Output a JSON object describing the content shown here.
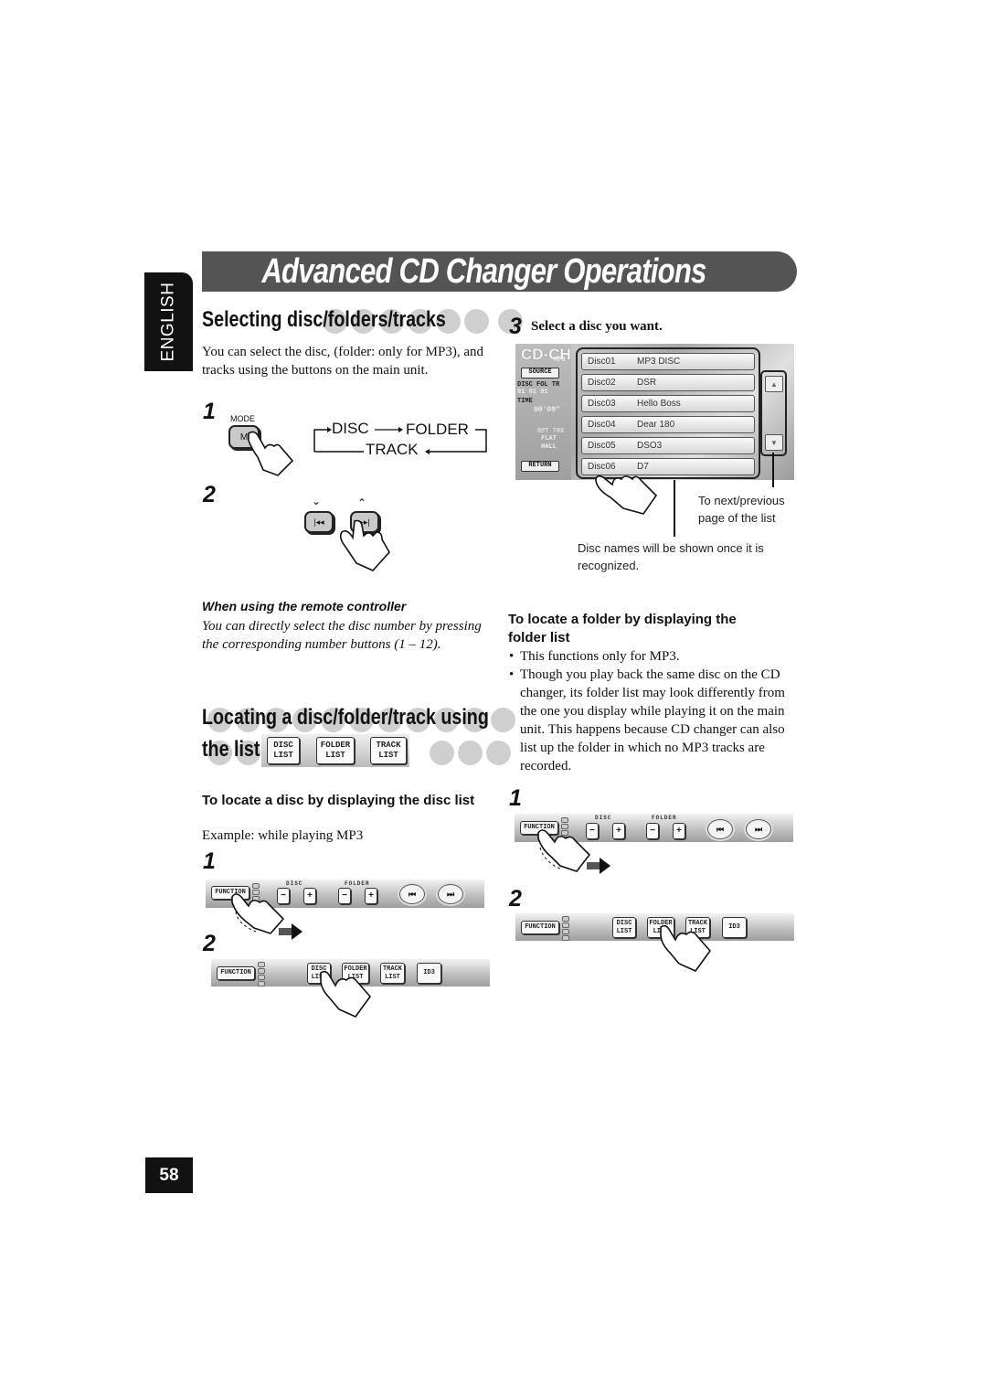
{
  "page": {
    "title": "Advanced CD Changer Operations",
    "language_tab": "ENGLISH",
    "page_number": "58"
  },
  "section1": {
    "heading": "Selecting disc/folders/tracks",
    "intro": "You can select the disc, (folder: only for MP3), and tracks using the buttons on the main unit.",
    "step1_number": "1",
    "mode_label": "MODE",
    "mode_button": "M",
    "cycle": {
      "disc": "DISC",
      "folder": "FOLDER",
      "track": "TRACK"
    },
    "step2_number": "2",
    "prev_button_icon": "skip-back-icon",
    "next_button_icon": "skip-forward-icon",
    "remote_heading": "When using the remote controller",
    "remote_text": "You can directly select the disc number by pressing the corresponding number buttons (1 – 12)."
  },
  "step3": {
    "number": "3",
    "label": "Select a disc you want.",
    "screen": {
      "logo": "CD-CH",
      "logo_sub": "MP3",
      "source_button": "SOURCE",
      "status_labels": "DISC FOL TR",
      "status_values": "01  01  01",
      "time_label": "TIME",
      "time_value": "00'09\"",
      "rpt": "RPT TRK",
      "eq": "FLAT",
      "dsp": "HALL",
      "return_button": "RETURN",
      "discs": [
        {
          "num": "Disc01",
          "name": "MP3 DISC"
        },
        {
          "num": "Disc02",
          "name": "DSR"
        },
        {
          "num": "Disc03",
          "name": "Hello Boss"
        },
        {
          "num": "Disc04",
          "name": "Dear 180"
        },
        {
          "num": "Disc05",
          "name": "DSO3"
        },
        {
          "num": "Disc06",
          "name": "D7"
        }
      ]
    },
    "callout_scroll": "To next/previous page of the list",
    "callout_names": "Disc names will be shown once it is recognized."
  },
  "section2": {
    "heading_line1": "Locating a disc/folder/track using",
    "heading_line2": "the list",
    "list_buttons": [
      {
        "l1": "DISC",
        "l2": "LIST"
      },
      {
        "l1": "FOLDER",
        "l2": "LIST"
      },
      {
        "l1": "TRACK",
        "l2": "LIST"
      }
    ],
    "disc_sub": {
      "heading": "To locate a disc by displaying the disc list",
      "example": "Example: while playing MP3",
      "step1": "1",
      "step2": "2"
    },
    "folder_sub": {
      "heading": "To locate a folder by displaying the folder list",
      "bullets": [
        "This functions only for MP3.",
        "Though you play back the same disc on the CD changer, its folder list may look differently from the one you display while playing it on the main unit. This happens because CD changer can also list up the folder in which no MP3 tracks are recorded."
      ],
      "step1": "1",
      "step2": "2"
    }
  },
  "function_bar": {
    "function_button": "FUNCTION",
    "disc_label": "DISC",
    "folder_label": "FOLDER",
    "minus": "−",
    "plus": "+",
    "prev": "⏮",
    "next": "⏭",
    "disc_list": "DISC LIST",
    "disc_list_l1": "DISC",
    "disc_list_l2": "LIST",
    "folder_list_l1": "FOLDER",
    "folder_list_l2": "LIST",
    "track_list_l1": "TRACK",
    "track_list_l2": "LIST",
    "id3": "ID3"
  }
}
